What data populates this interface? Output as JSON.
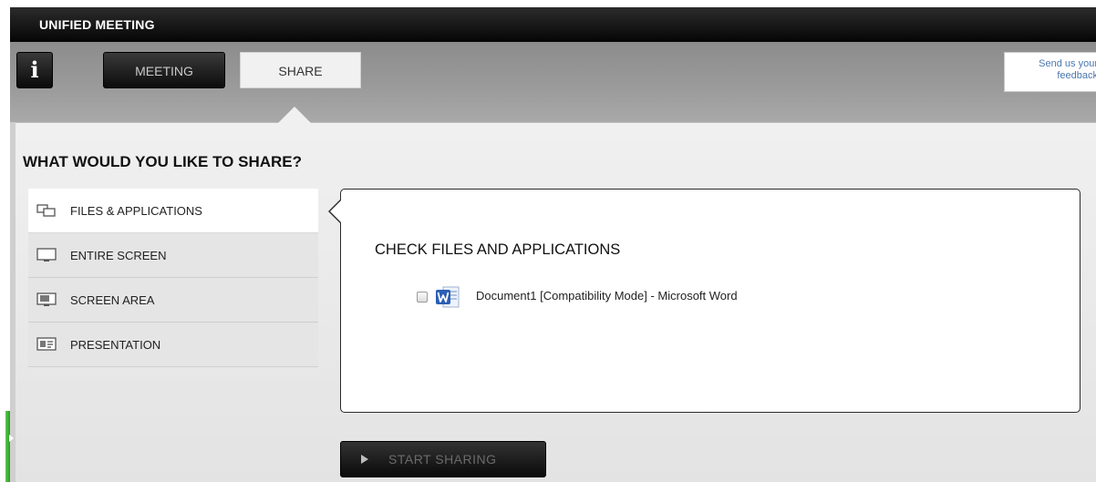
{
  "app": {
    "title": "UNIFIED MEETING"
  },
  "toolbar": {
    "info_label": "i",
    "tabs": [
      {
        "label": "MEETING",
        "selected": false
      },
      {
        "label": "SHARE",
        "selected": true
      }
    ],
    "feedback_label": "Send us your feedback"
  },
  "share": {
    "heading": "WHAT WOULD YOU LIKE TO SHARE?",
    "options": [
      {
        "label": "FILES & APPLICATIONS",
        "icon": "windows-icon",
        "selected": true
      },
      {
        "label": "ENTIRE SCREEN",
        "icon": "monitor-icon",
        "selected": false
      },
      {
        "label": "SCREEN AREA",
        "icon": "screen-area-icon",
        "selected": false
      },
      {
        "label": "PRESENTATION",
        "icon": "presentation-icon",
        "selected": false
      }
    ],
    "panel": {
      "title": "CHECK FILES AND APPLICATIONS",
      "files": [
        {
          "label": "Document1 [Compatibility Mode] - Microsoft Word",
          "icon": "word-icon",
          "checked": false
        }
      ]
    },
    "start_button_label": "START SHARING"
  },
  "colors": {
    "title_bar": "#000000",
    "accent_green": "#3fae33",
    "feedback_link": "#4a77b0"
  }
}
